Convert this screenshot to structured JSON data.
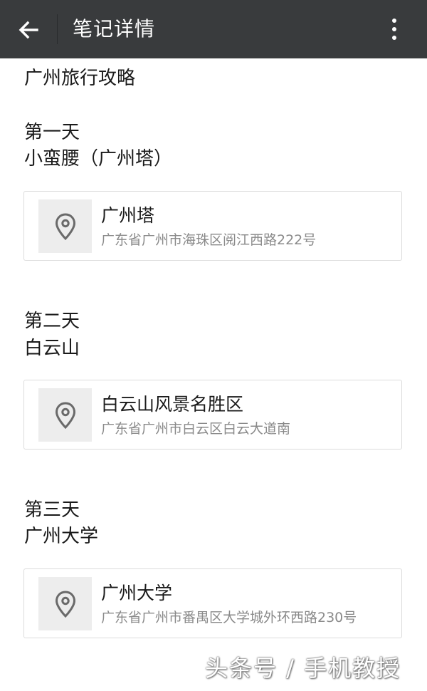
{
  "header": {
    "title": "笔记详情",
    "back_icon": "arrow-left-icon",
    "more_icon": "more-vertical-icon",
    "bar_color": "#393b3d"
  },
  "note": {
    "title": "广州旅行攻略",
    "days": [
      {
        "day": "第一天",
        "place": "小蛮腰（广州塔）",
        "location": {
          "name": "广州塔",
          "address": "广东省广州市海珠区阅江西路222号",
          "icon": "location-pin-icon"
        }
      },
      {
        "day": "第二天",
        "place": "白云山",
        "location": {
          "name": "白云山风景名胜区",
          "address": "广东省广州市白云区白云大道南",
          "icon": "location-pin-icon"
        }
      },
      {
        "day": "第三天",
        "place": "广州大学",
        "location": {
          "name": "广州大学",
          "address": "广东省广州市番禺区大学城外环西路230号",
          "icon": "location-pin-icon"
        }
      }
    ]
  },
  "watermark": "头条号 / 手机教授"
}
